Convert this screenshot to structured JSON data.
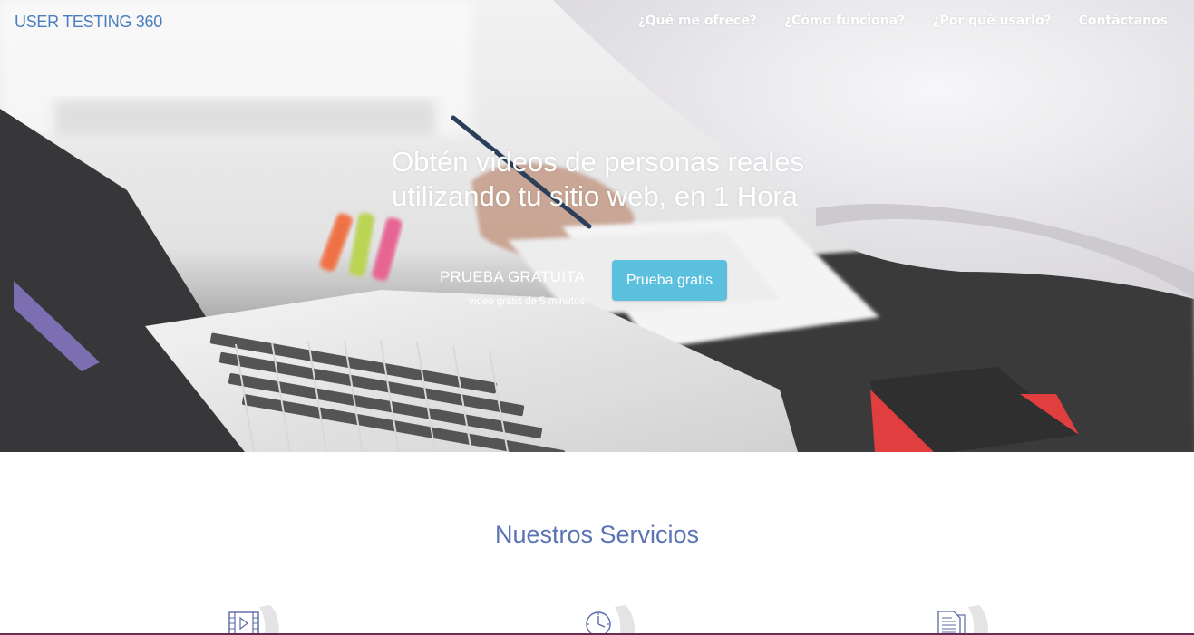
{
  "header": {
    "logo_text": "USER TESTING 360",
    "nav": [
      {
        "label": "¿Qué me ofrece?"
      },
      {
        "label": "¿Cómo funciona?"
      },
      {
        "label": "¿Por qué usarlo?"
      },
      {
        "label": "Contáctanos"
      }
    ]
  },
  "hero": {
    "headline_line1": "Obtén videos de personas reales",
    "headline_line2": "utilizando tu sitio web, en 1 Hora",
    "promo_title": "PRUEBA GRATUITA",
    "promo_subtitle": "video gratis de 5 minutos",
    "cta_label": "Prueba gratis"
  },
  "services": {
    "title": "Nuestros Servicios",
    "items": [
      {
        "icon": "video-icon"
      },
      {
        "icon": "clock-icon"
      },
      {
        "icon": "document-icon"
      }
    ]
  },
  "colors": {
    "logo": "#4a7fbf",
    "cta_background": "#5bc0de",
    "services_title": "#5a73b3",
    "icon_stroke": "#5a6aa6"
  }
}
